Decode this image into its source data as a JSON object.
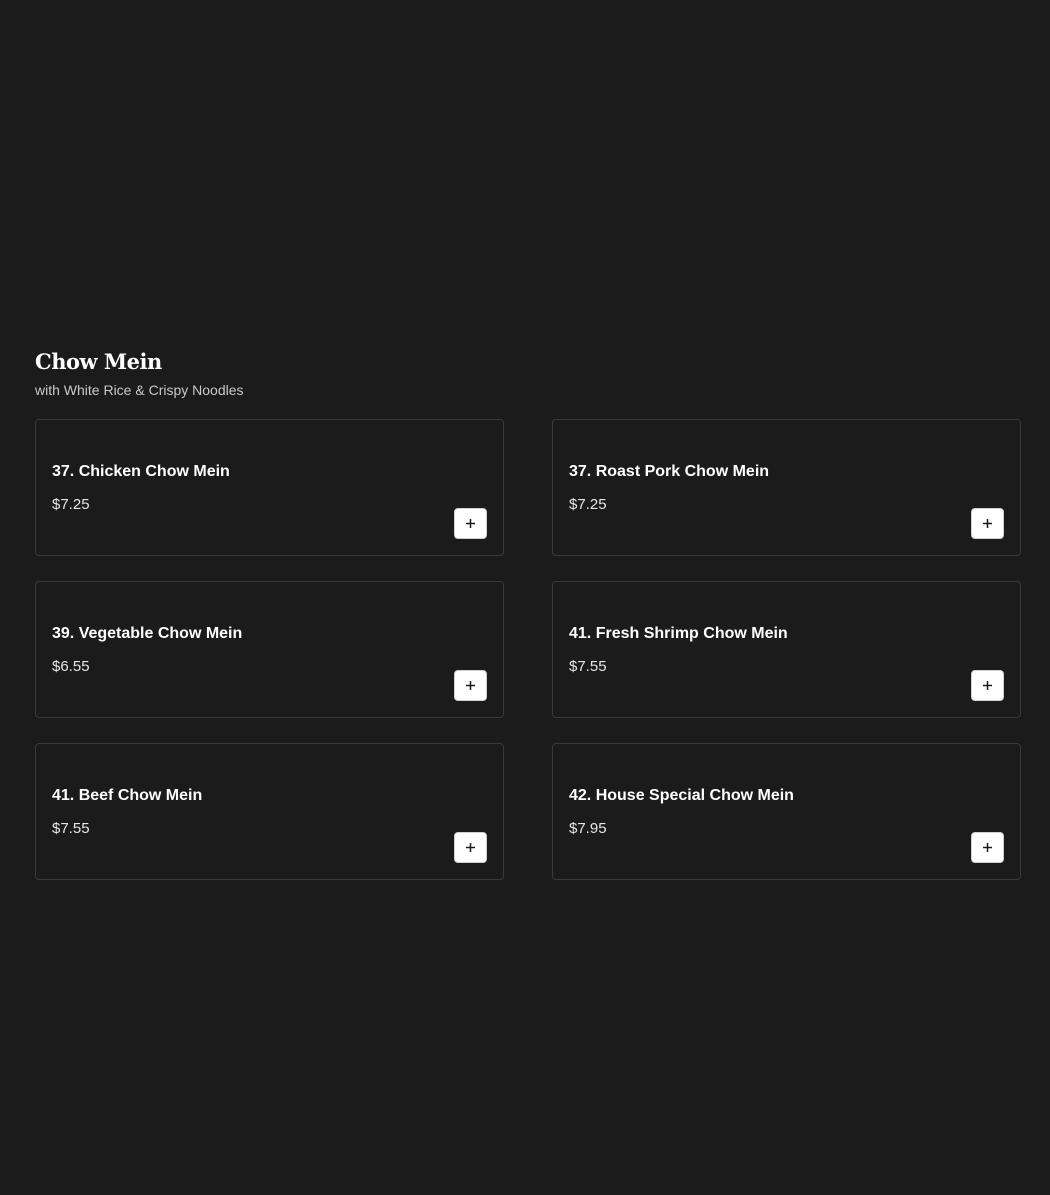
{
  "section": {
    "title": "Chow Mein",
    "subtitle": "with White Rice & Crispy Noodles"
  },
  "items": [
    {
      "name": "37. Chicken Chow Mein",
      "price": "$7.25"
    },
    {
      "name": "37. Roast Pork Chow Mein",
      "price": "$7.25"
    },
    {
      "name": "39. Vegetable Chow Mein",
      "price": "$6.55"
    },
    {
      "name": "41. Fresh Shrimp Chow Mein",
      "price": "$7.55"
    },
    {
      "name": "41. Beef Chow Mein",
      "price": "$7.55"
    },
    {
      "name": "42. House Special Chow Mein",
      "price": "$7.95"
    }
  ],
  "icons": {
    "add": "plus-icon"
  },
  "colors": {
    "background": "#1b1b1b",
    "card_border": "#3a3a3a",
    "text": "#ffffff",
    "button_bg": "#ffffff"
  }
}
